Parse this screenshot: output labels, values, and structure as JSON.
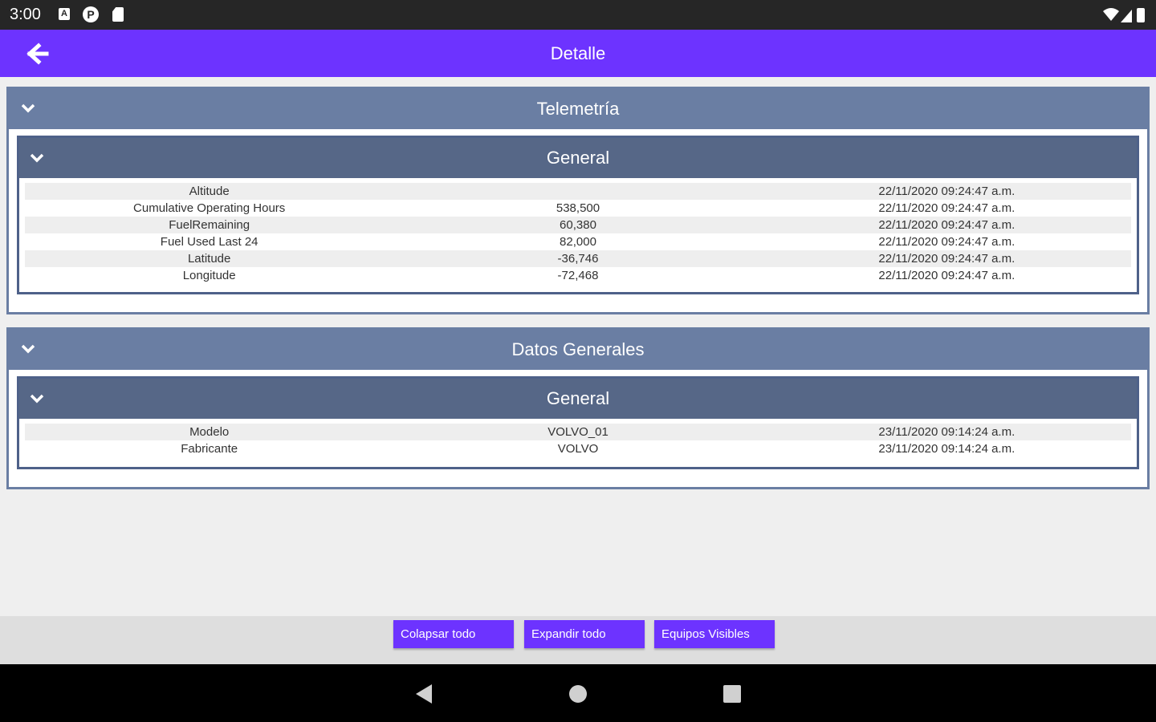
{
  "status_bar": {
    "time": "3:00"
  },
  "app_bar": {
    "title": "Detalle"
  },
  "sections": [
    {
      "title": "Telemetría",
      "groups": [
        {
          "title": "General",
          "rows": [
            [
              "Altitude",
              "",
              "22/11/2020 09:24:47 a.m."
            ],
            [
              "Cumulative Operating Hours",
              "538,500",
              "22/11/2020 09:24:47 a.m."
            ],
            [
              "FuelRemaining",
              "60,380",
              "22/11/2020 09:24:47 a.m."
            ],
            [
              "Fuel Used Last 24",
              "82,000",
              "22/11/2020 09:24:47 a.m."
            ],
            [
              "Latitude",
              "-36,746",
              "22/11/2020 09:24:47 a.m."
            ],
            [
              "Longitude",
              "-72,468",
              "22/11/2020 09:24:47 a.m."
            ]
          ]
        }
      ]
    },
    {
      "title": "Datos Generales",
      "groups": [
        {
          "title": "General",
          "rows": [
            [
              "Modelo",
              "VOLVO_01",
              "23/11/2020 09:14:24 a.m."
            ],
            [
              "Fabricante",
              "VOLVO",
              "23/11/2020 09:14:24 a.m."
            ]
          ]
        }
      ]
    }
  ],
  "toolbar": {
    "collapse_label": "Colapsar todo",
    "expand_label": "Expandir todo",
    "visible_label": "Equipos Visibles"
  },
  "icons": {
    "back": "arrow-left-icon",
    "chevron": "chevron-down-icon",
    "wifi": "wifi-icon",
    "signal": "cell-signal-icon",
    "battery": "battery-icon"
  },
  "colors": {
    "accent": "#6d33ff",
    "section_header": "#6a7ea3",
    "group_header": "#566787"
  }
}
